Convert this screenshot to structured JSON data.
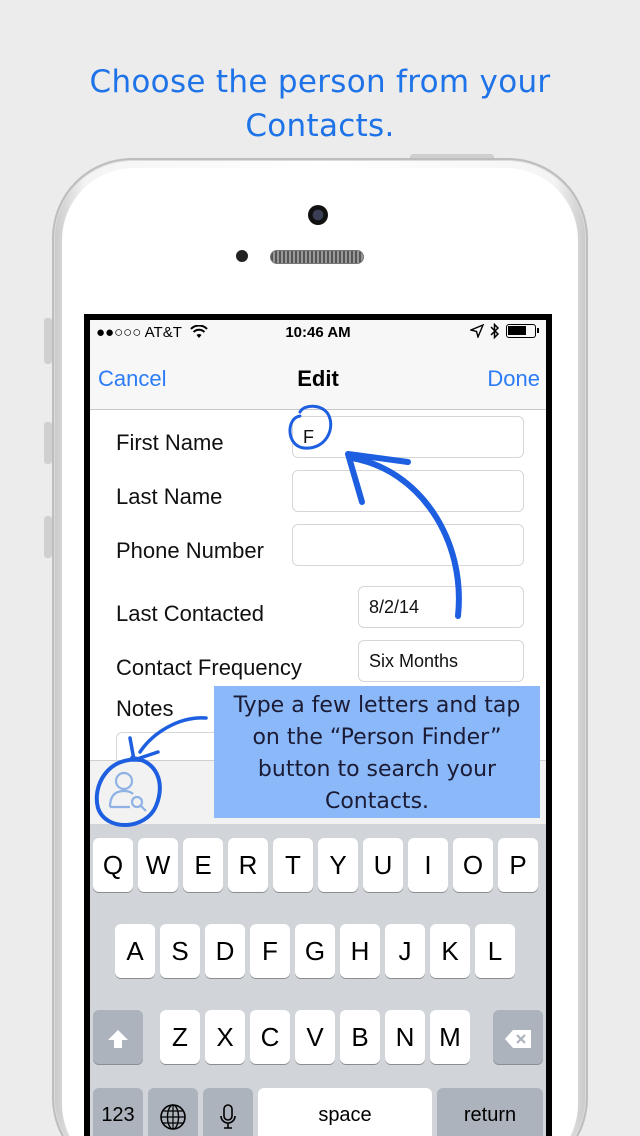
{
  "headline": {
    "line1": "Choose the person from your",
    "line2": "Contacts."
  },
  "status_bar": {
    "carrier": "●●○○○ AT&T",
    "time": "10:46 AM"
  },
  "nav": {
    "cancel": "Cancel",
    "title": "Edit",
    "done": "Done"
  },
  "form": {
    "first_name_label": "First Name",
    "first_name_value": "F",
    "last_name_label": "Last Name",
    "phone_label": "Phone Number",
    "last_contacted_label": "Last Contacted",
    "last_contacted_value": "8/2/14",
    "frequency_label": "Contact Frequency",
    "frequency_value": "Six Months",
    "notes_label": "Notes"
  },
  "tooltip": {
    "text": "Type a few letters and tap on the “Person Finder” button to search your Contacts."
  },
  "keyboard": {
    "row1": [
      "Q",
      "W",
      "E",
      "R",
      "T",
      "Y",
      "U",
      "I",
      "O",
      "P"
    ],
    "row2": [
      "A",
      "S",
      "D",
      "F",
      "G",
      "H",
      "J",
      "K",
      "L"
    ],
    "row3": [
      "Z",
      "X",
      "C",
      "V",
      "B",
      "N",
      "M"
    ],
    "numbers": "123",
    "space": "space",
    "return": "return"
  },
  "icons": {
    "status": [
      "wifi-icon",
      "location-arrow-icon",
      "bluetooth-icon",
      "battery-icon"
    ],
    "keys": [
      "shift-icon",
      "backspace-icon",
      "globe-icon",
      "microphone-icon"
    ],
    "accessory": "person-finder-icon"
  },
  "colors": {
    "accent": "#2c7cf6",
    "headline": "#1e73e8",
    "tooltip_bg": "#8ab8f8",
    "annotation": "#1d5fe0"
  }
}
